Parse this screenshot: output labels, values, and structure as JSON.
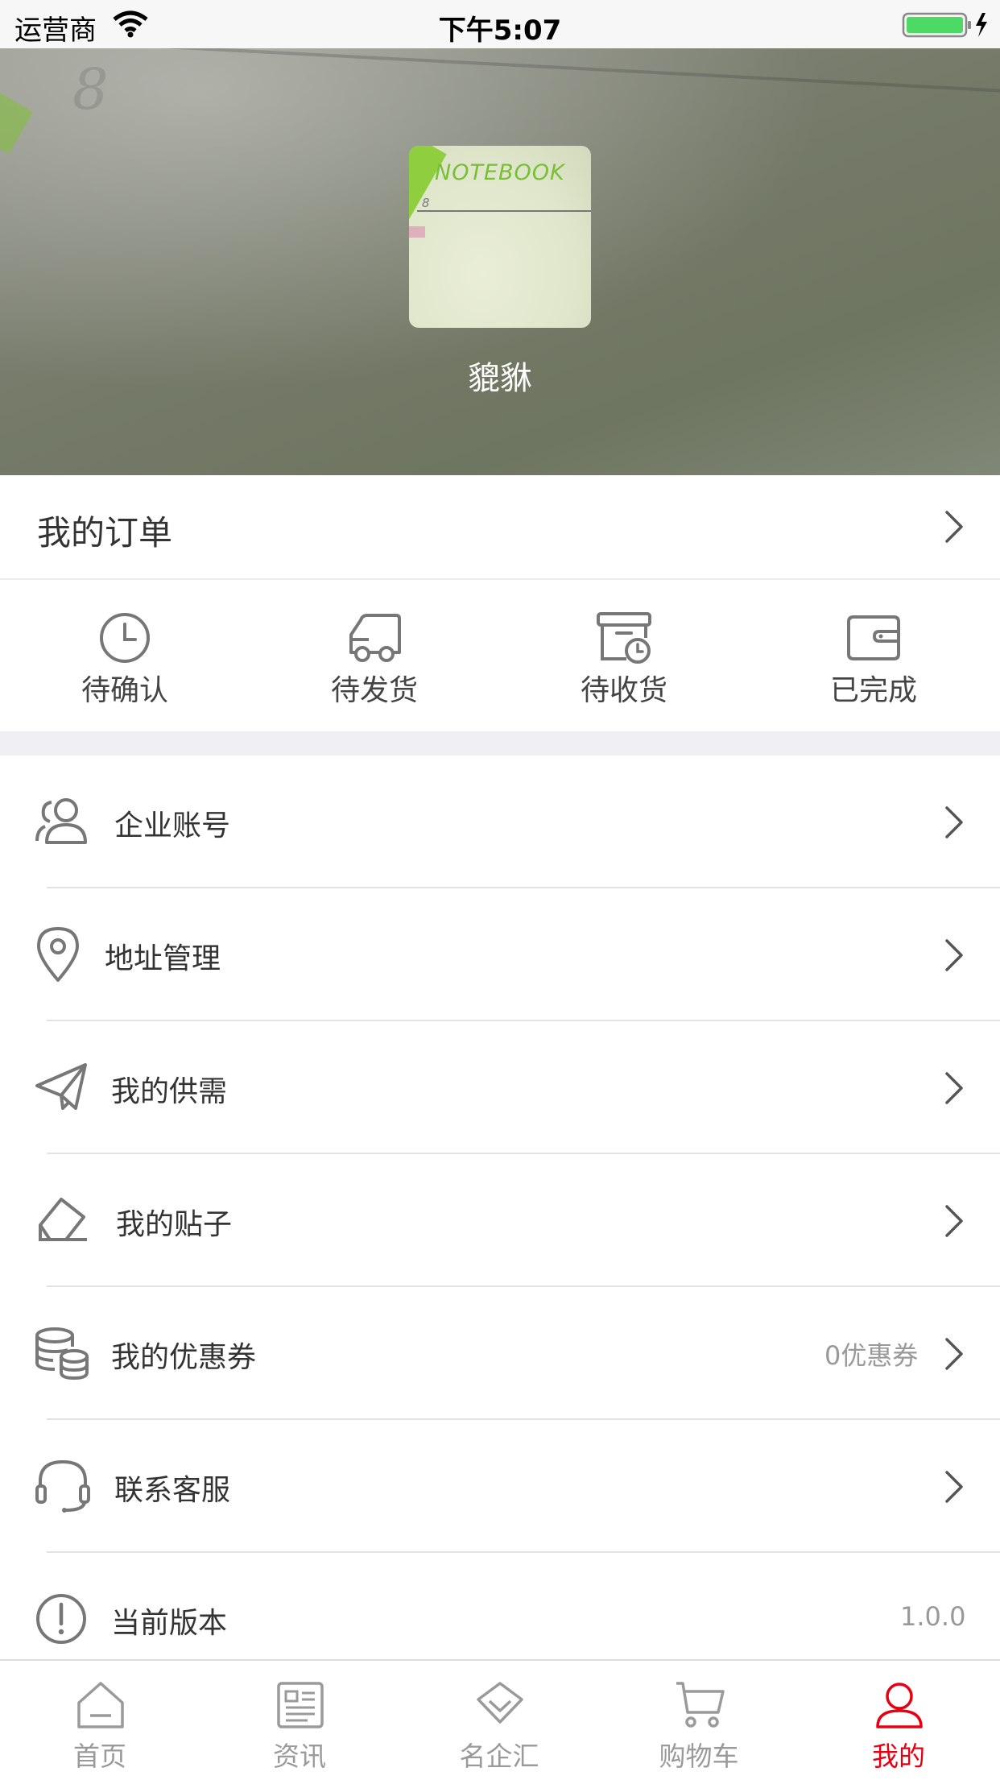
{
  "status_bar": {
    "carrier": "运营商",
    "time": "下午5:07"
  },
  "profile": {
    "name": "貔貅",
    "avatar_text": "NOTEBOOK"
  },
  "orders": {
    "title": "我的订单",
    "statuses": [
      {
        "label": "待确认",
        "icon": "clock-icon"
      },
      {
        "label": "待发货",
        "icon": "truck-icon"
      },
      {
        "label": "待收货",
        "icon": "package-clock-icon"
      },
      {
        "label": "已完成",
        "icon": "wallet-icon"
      }
    ]
  },
  "menu": {
    "items": [
      {
        "label": "企业账号",
        "icon": "users-icon",
        "value": ""
      },
      {
        "label": "地址管理",
        "icon": "location-pin-icon",
        "value": ""
      },
      {
        "label": "我的供需",
        "icon": "paper-plane-icon",
        "value": ""
      },
      {
        "label": "我的贴子",
        "icon": "eraser-icon",
        "value": ""
      },
      {
        "label": "我的优惠券",
        "icon": "coins-icon",
        "value": "0优惠券"
      },
      {
        "label": "联系客服",
        "icon": "headset-icon",
        "value": ""
      },
      {
        "label": "当前版本",
        "icon": "info-icon",
        "value": "1.0.0"
      }
    ]
  },
  "tabbar": {
    "tabs": [
      {
        "label": "首页",
        "icon": "home-icon",
        "active": false
      },
      {
        "label": "资讯",
        "icon": "news-icon",
        "active": false
      },
      {
        "label": "名企汇",
        "icon": "diamond-icon",
        "active": false
      },
      {
        "label": "购物车",
        "icon": "cart-icon",
        "active": false
      },
      {
        "label": "我的",
        "icon": "user-icon",
        "active": true
      }
    ],
    "active_color": "#e60012",
    "inactive_color": "#9a9a9a"
  }
}
